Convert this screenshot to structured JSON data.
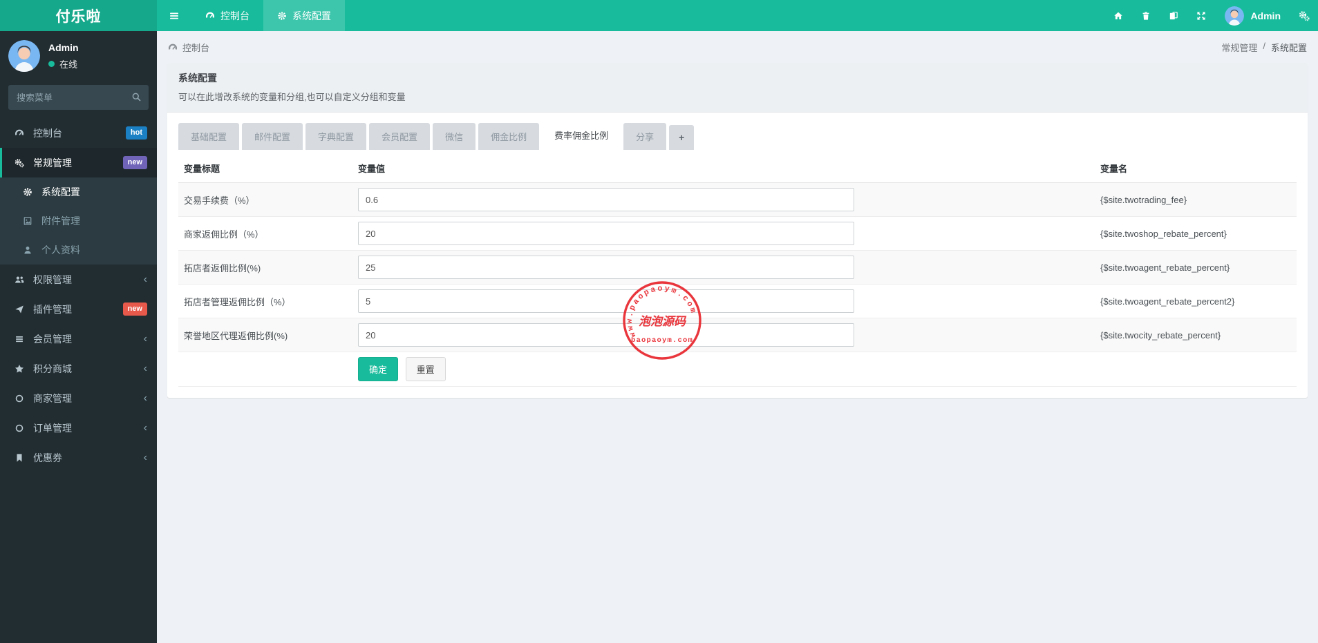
{
  "brand": {
    "title": "付乐啦"
  },
  "topbar": {
    "tabs": [
      {
        "label": "控制台"
      },
      {
        "label": "系统配置"
      }
    ],
    "user_name": "Admin"
  },
  "sidebar": {
    "user": {
      "name": "Admin",
      "status": "在线"
    },
    "search_placeholder": "搜索菜单",
    "items": [
      {
        "label": "控制台",
        "badge": "hot",
        "badge_color": "#1b80c4"
      },
      {
        "label": "常规管理",
        "badge": "new",
        "badge_color": "#6f64b8"
      },
      {
        "label": "权限管理"
      },
      {
        "label": "插件管理",
        "badge": "new",
        "badge_color": "#e8594b"
      },
      {
        "label": "会员管理"
      },
      {
        "label": "积分商城"
      },
      {
        "label": "商家管理"
      },
      {
        "label": "订单管理"
      },
      {
        "label": "优惠券"
      }
    ],
    "general_children": [
      {
        "label": "系统配置"
      },
      {
        "label": "附件管理"
      },
      {
        "label": "个人资料"
      }
    ]
  },
  "content": {
    "breadcrumb_left": "控制台",
    "breadcrumb_right": {
      "parent": "常规管理",
      "separator": "/",
      "current": "系统配置"
    },
    "panel": {
      "title": "系统配置",
      "description": "可以在此增改系统的变量和分组,也可以自定义分组和变量",
      "tabs": [
        "基础配置",
        "邮件配置",
        "字典配置",
        "会员配置",
        "微信",
        "佣金比例",
        "费率佣金比例",
        "分享"
      ],
      "active_tab": "费率佣金比例",
      "add_tab_label": "+",
      "table": {
        "headers": [
          "变量标题",
          "变量值",
          "变量名"
        ],
        "rows": [
          {
            "title": "交易手续费（%）",
            "value": "0.6",
            "name": "{$site.twotrading_fee}"
          },
          {
            "title": "商家返佣比例（%）",
            "value": "20",
            "name": "{$site.twoshop_rebate_percent}"
          },
          {
            "title": "拓店者返佣比例(%)",
            "value": "25",
            "name": "{$site.twoagent_rebate_percent}"
          },
          {
            "title": "拓店者管理返佣比例（%）",
            "value": "5",
            "name": "{$site.twoagent_rebate_percent2}"
          },
          {
            "title": "荣誉地区代理返佣比例(%)",
            "value": "20",
            "name": "{$site.twocity_rebate_percent}"
          }
        ]
      },
      "buttons": {
        "ok": "确定",
        "reset": "重置"
      }
    }
  },
  "watermark": {
    "arc_text": "www.paopaoym.com",
    "center_text": "泡泡源码",
    "bottom_text": "paopaoym.com",
    "color": "#e8262d"
  },
  "colors": {
    "accent": "#18bc9c",
    "sidebar_bg": "#222d32",
    "content_bg": "#eef1f5"
  }
}
